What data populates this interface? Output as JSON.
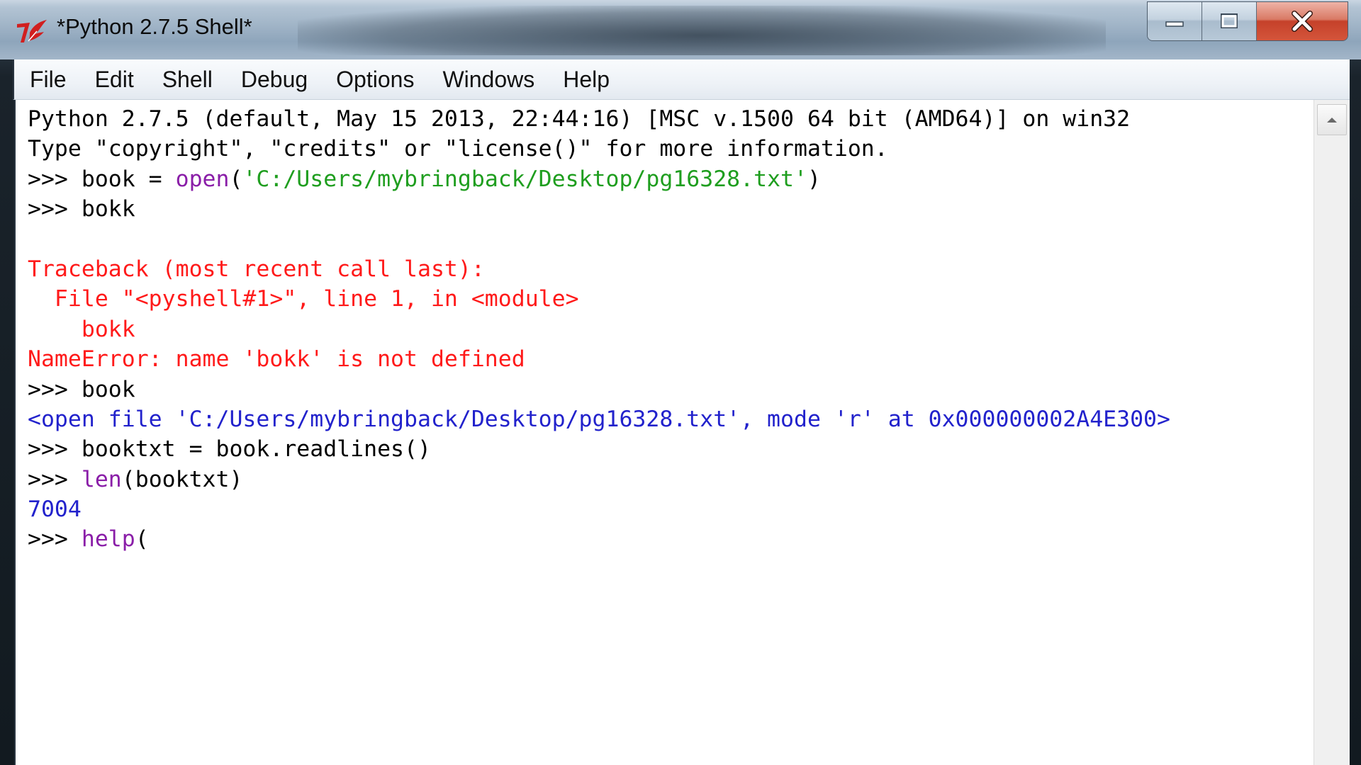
{
  "window": {
    "title": "*Python 2.7.5 Shell*"
  },
  "menu": [
    {
      "label": "File"
    },
    {
      "label": "Edit"
    },
    {
      "label": "Shell"
    },
    {
      "label": "Debug"
    },
    {
      "label": "Options"
    },
    {
      "label": "Windows"
    },
    {
      "label": "Help"
    }
  ],
  "shell": {
    "lines": [
      [
        {
          "t": "Python 2.7.5 (default, May 15 2013, 22:44:16) [MSC v.1500 64 bit (AMD64)] on win32",
          "c": "out"
        }
      ],
      [
        {
          "t": "Type \"copyright\", \"credits\" or \"license()\" for more information.",
          "c": "out"
        }
      ],
      [
        {
          "t": ">>> ",
          "c": "prompt"
        },
        {
          "t": "book = ",
          "c": "out"
        },
        {
          "t": "open",
          "c": "bi"
        },
        {
          "t": "(",
          "c": "out"
        },
        {
          "t": "'C:/Users/mybringback/Desktop/pg16328.txt'",
          "c": "str"
        },
        {
          "t": ")",
          "c": "out"
        }
      ],
      [
        {
          "t": ">>> ",
          "c": "prompt"
        },
        {
          "t": "bokk",
          "c": "out"
        }
      ],
      [],
      [
        {
          "t": "Traceback (most recent call last):",
          "c": "err"
        }
      ],
      [
        {
          "t": "  File \"<pyshell#1>\", line 1, in <module>",
          "c": "err"
        }
      ],
      [
        {
          "t": "    bokk",
          "c": "err"
        }
      ],
      [
        {
          "t": "NameError: name 'bokk' is not defined",
          "c": "err"
        }
      ],
      [
        {
          "t": ">>> ",
          "c": "prompt"
        },
        {
          "t": "book",
          "c": "out"
        }
      ],
      [
        {
          "t": "<open file 'C:/Users/mybringback/Desktop/pg16328.txt', mode 'r' at 0x000000002A4E300>",
          "c": "stdout"
        }
      ],
      [
        {
          "t": ">>> ",
          "c": "prompt"
        },
        {
          "t": "booktxt = book.readlines()",
          "c": "out"
        }
      ],
      [
        {
          "t": ">>> ",
          "c": "prompt"
        },
        {
          "t": "len",
          "c": "bi"
        },
        {
          "t": "(booktxt)",
          "c": "out"
        }
      ],
      [
        {
          "t": "7004",
          "c": "stdout"
        }
      ],
      [
        {
          "t": ">>> ",
          "c": "prompt"
        },
        {
          "t": "help",
          "c": "bi"
        },
        {
          "t": "(",
          "c": "out"
        }
      ]
    ]
  },
  "colors": {
    "error": "#ff1a1a",
    "stdout": "#2222cc",
    "string": "#1f9e1f",
    "builtin": "#8a1ea8",
    "close_button": "#c5412a"
  },
  "icons": {
    "app": "tk-feather-icon",
    "minimize": "minimize-icon",
    "maximize": "maximize-icon",
    "close": "close-icon",
    "scroll_up": "scroll-up-arrow-icon"
  }
}
